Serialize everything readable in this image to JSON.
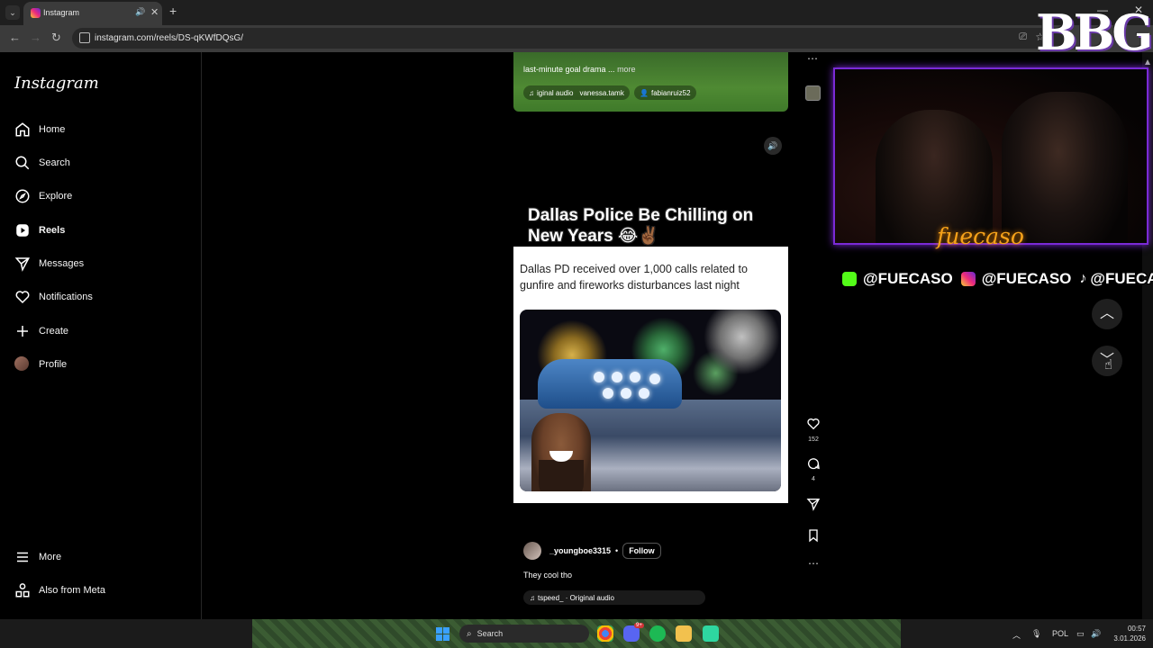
{
  "browser": {
    "tab_title": "Instagram",
    "url": "instagram.com/reels/DS-qKWfDQsG/"
  },
  "sidebar": {
    "logo": "Instagram",
    "items": [
      {
        "label": "Home",
        "icon": "home-icon"
      },
      {
        "label": "Search",
        "icon": "search-icon"
      },
      {
        "label": "Explore",
        "icon": "compass-icon"
      },
      {
        "label": "Reels",
        "icon": "reels-icon",
        "active": true
      },
      {
        "label": "Messages",
        "icon": "send-icon"
      },
      {
        "label": "Notifications",
        "icon": "heart-icon"
      },
      {
        "label": "Create",
        "icon": "plus-icon"
      },
      {
        "label": "Profile",
        "icon": "avatar"
      }
    ],
    "bottom": [
      {
        "label": "More",
        "icon": "menu-icon"
      },
      {
        "label": "Also from Meta",
        "icon": "meta-grid-icon"
      }
    ]
  },
  "top_reel": {
    "caption": "last-minute goal drama ...",
    "more": "more",
    "audio": "iginal audio",
    "audio_user": "vanessa.tamk",
    "tagged_user": "fabianruiz52"
  },
  "reel": {
    "title": "Dallas Police Be Chilling on New Years 😂✌🏾",
    "tweet_text": "Dallas PD received over 1,000 calls related to gunfire and fireworks disturbances last night",
    "author": "_youngboe3315",
    "follow_label": "Follow",
    "caption": "They cool tho",
    "audio": "tspeed_ · Original audio",
    "likes": "152",
    "comments": "4"
  },
  "overlay": {
    "signature": "fuecaso",
    "socials": [
      {
        "handle": "@FUECASO",
        "platform": "kick",
        "color": "#53fc18"
      },
      {
        "handle": "@FUECASO",
        "platform": "instagram",
        "color": "#e1306c"
      },
      {
        "handle": "@FUECASOO",
        "platform": "tiktok",
        "color": "#ffffff"
      }
    ],
    "logo": "BBG",
    "frame_color": "#7a2ad6"
  },
  "taskbar": {
    "search_placeholder": "Search",
    "language": "POL",
    "time": "00:57",
    "date": "3.01.2026",
    "discord_badge": "9+"
  }
}
